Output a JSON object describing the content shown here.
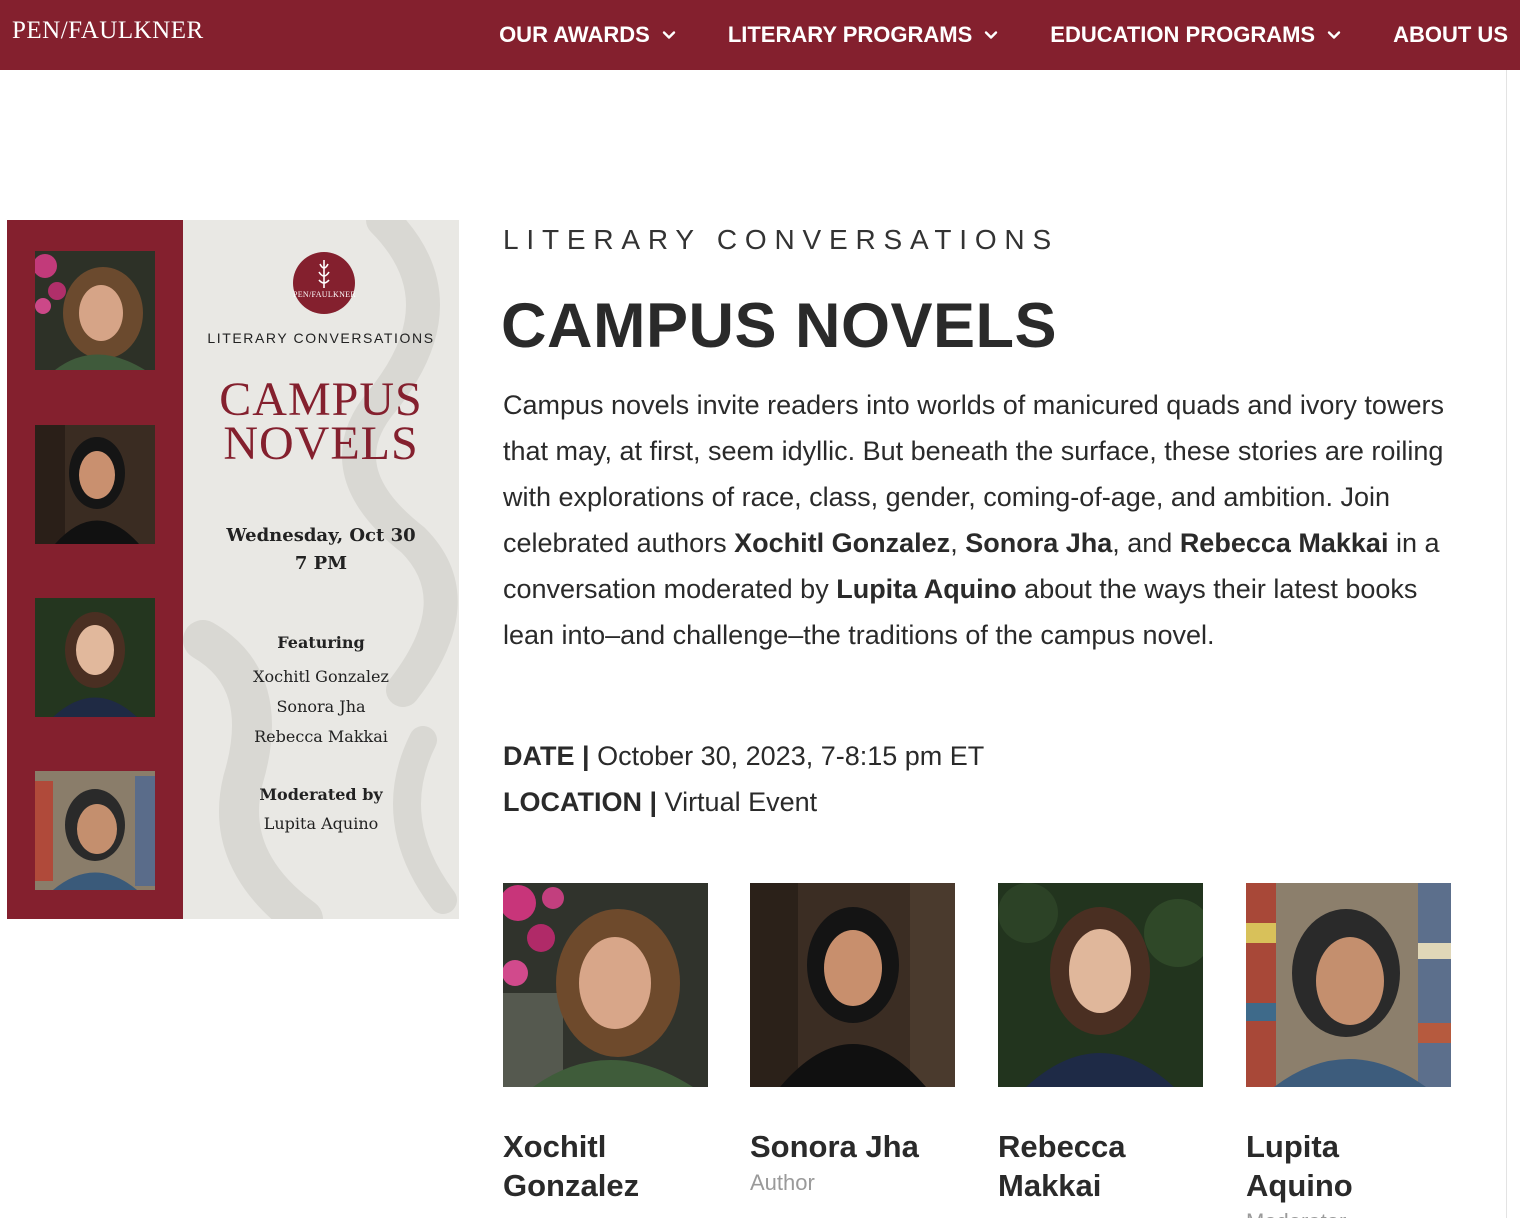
{
  "header": {
    "logo": "PEN/FAULKNER",
    "nav": [
      {
        "label": "OUR AWARDS",
        "has_dropdown": true
      },
      {
        "label": "LITERARY PROGRAMS",
        "has_dropdown": true
      },
      {
        "label": "EDUCATION PROGRAMS",
        "has_dropdown": true
      },
      {
        "label": "ABOUT US",
        "has_dropdown": false
      }
    ]
  },
  "poster": {
    "seal_text": "PEN/FAULKNER",
    "series": "LITERARY CONVERSATIONS",
    "title_line1": "CAMPUS",
    "title_line2": "NOVELS",
    "date_line1": "Wednesday, Oct 30",
    "date_line2": "7 PM",
    "featuring_label": "Featuring",
    "featuring": [
      "Xochitl Gonzalez",
      "Sonora Jha",
      "Rebecca Makkai"
    ],
    "moderated_label": "Moderated by",
    "moderator": "Lupita Aquino"
  },
  "event": {
    "kicker": "LITERARY CONVERSATIONS",
    "title": "CAMPUS NOVELS",
    "description": {
      "part1": "Campus novels invite readers into worlds of manicured quads and ivory towers that may, at first, seem idyllic. But beneath the surface, these stories are roiling with explorations of race, class, gender, coming-of-age, and ambition. Join celebrated authors ",
      "name1": "Xochitl Gonzalez",
      "sep1": ", ",
      "name2": "Sonora Jha",
      "sep2": ", and ",
      "name3": "Rebecca Makkai",
      "part2": " in a conversation moderated by ",
      "name4": "Lupita Aquino",
      "part3": " about the ways their latest books lean into–and challenge–the traditions of the campus novel."
    },
    "date_label": "DATE |",
    "date_value": " October 30, 2023, 7-8:15 pm ET",
    "location_label": "LOCATION |",
    "location_value": " Virtual Event"
  },
  "participants": [
    {
      "name": "Xochitl Gonzalez",
      "role": ""
    },
    {
      "name": "Sonora Jha",
      "role": "Author"
    },
    {
      "name": "Rebecca Makkai",
      "role": ""
    },
    {
      "name": "Lupita Aquino",
      "role": "Moderator"
    }
  ],
  "colors": {
    "brand": "#84202e",
    "text": "#2a2a2a",
    "muted": "#9a9a9a",
    "poster_bg": "#e9e8e4"
  }
}
